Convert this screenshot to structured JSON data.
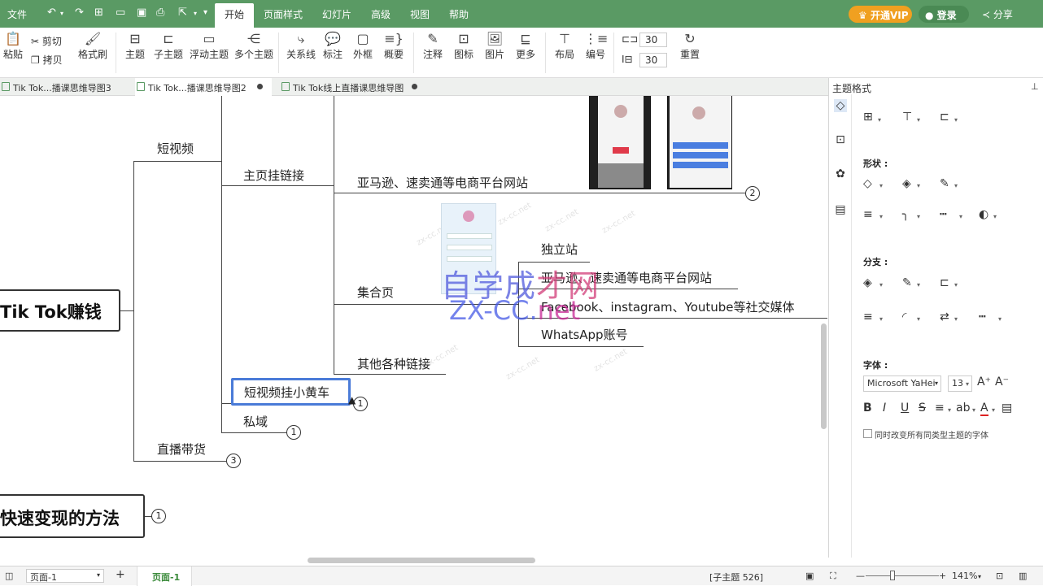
{
  "menubar": {
    "file": "文件",
    "tabs": [
      "开始",
      "页面样式",
      "幻灯片",
      "高级",
      "视图",
      "帮助"
    ],
    "vip": "开通VIP",
    "login": "登录",
    "share": "分享"
  },
  "ribbon": {
    "paste": "粘贴",
    "cut": "剪切",
    "copy": "拷贝",
    "format_brush": "格式刷",
    "topic": "主题",
    "subtopic": "子主题",
    "floating_topic": "浮动主题",
    "multi_topic": "多个主题",
    "relation": "关系线",
    "callout": "标注",
    "boundary": "外框",
    "summary": "概要",
    "note": "注释",
    "icon": "图标",
    "image": "图片",
    "more": "更多",
    "layout": "布局",
    "numbering": "编号",
    "spacing_h": "30",
    "spacing_v": "30",
    "reset": "重置"
  },
  "doc_tabs": [
    {
      "label": "Tik Tok...播课思维导图3"
    },
    {
      "label": "Tik Tok...播课思维导图2"
    },
    {
      "label": "Tik Tok线上直播课思维导图"
    }
  ],
  "mindmap": {
    "central": "Tik Tok赚钱",
    "main2": "快速变现的方法",
    "main2_badge": "1",
    "short_video": "短视频",
    "homepage_link": "主页挂链接",
    "amazon_1": "亚马逊、速卖通等电商平台网站",
    "amazon_1_badge": "2",
    "collection_page": "集合页",
    "indie_site": "独立站",
    "amazon_2": "亚马逊、速卖通等电商平台网站",
    "facebook": "Facebook、instagram、Youtube等社交媒体",
    "whatsapp": "WhatsApp账号",
    "other_links": "其他各种链接",
    "yellow_cart": "短视频挂小黄车",
    "yellow_cart_badge": "1",
    "private_domain": "私域",
    "private_domain_badge": "1",
    "live": "直播带货",
    "live_badge": "3"
  },
  "watermark": {
    "title_a": "自学成",
    "title_b": "才网",
    "url_a": "ZX-CC.",
    "url_b": "net",
    "small": "zx-cc.net"
  },
  "panel": {
    "title": "主题格式",
    "shape": "形状 :",
    "branch": "分支 :",
    "font": "字体 :",
    "font_name": "Microsoft YaHei",
    "font_size": "13",
    "apply_all": "同时改变所有同类型主题的字体"
  },
  "statusbar": {
    "page_select": "页面-1",
    "page_tab": "页面-1",
    "subtopic_count": "[子主题 526]",
    "zoom": "141%"
  }
}
